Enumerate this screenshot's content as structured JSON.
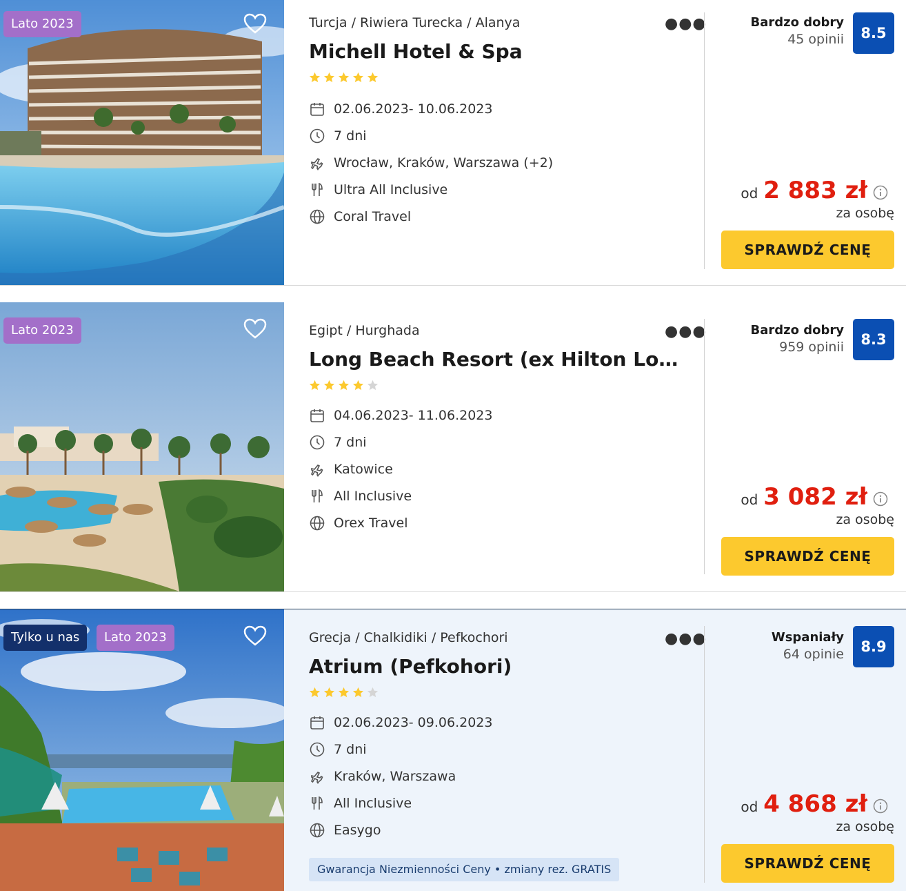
{
  "offers": [
    {
      "badges": [
        "Lato 2023"
      ],
      "location": "Turcja / Riwiera Turecka / Alanya",
      "name": "Michell Hotel & Spa",
      "stars": 5,
      "dates": "02.06.2023- 10.06.2023",
      "duration": "7 dni",
      "departure": "Wrocław, Kraków, Warszawa  (+2)",
      "board": "Ultra All Inclusive",
      "operator": "Coral Travel",
      "rating_label": "Bardzo dobry",
      "rating_count": "45 opinii",
      "score": "8.5",
      "price_prefix": "od",
      "price": "2 883 zł",
      "price_suffix": "za osobę",
      "button": "SPRAWDŹ CENĘ"
    },
    {
      "badges": [
        "Lato 2023"
      ],
      "location": "Egipt / Hurghada",
      "name": "Long Beach Resort (ex Hilton Long Be...",
      "stars": 4,
      "dates": "04.06.2023- 11.06.2023",
      "duration": "7 dni",
      "departure": "Katowice",
      "board": "All Inclusive",
      "operator": "Orex Travel",
      "rating_label": "Bardzo dobry",
      "rating_count": "959 opinii",
      "score": "8.3",
      "price_prefix": "od",
      "price": "3 082 zł",
      "price_suffix": "za osobę",
      "button": "SPRAWDŹ CENĘ"
    },
    {
      "badges": [
        "Tylko u nas",
        "Lato 2023"
      ],
      "location": "Grecja / Chalkidiki / Pefkochori",
      "name": "Atrium (Pefkohori)",
      "stars": 4,
      "dates": "02.06.2023- 09.06.2023",
      "duration": "7 dni",
      "departure": "Kraków, Warszawa",
      "board": "All Inclusive",
      "operator": "Easygo",
      "guarantee": "Gwarancja Niezmienności Ceny • zmiany rez. GRATIS",
      "rating_label": "Wspaniały",
      "rating_count": "64 opinie",
      "score": "8.9",
      "price_prefix": "od",
      "price": "4 868 zł",
      "price_suffix": "za osobę",
      "button": "SPRAWDŹ CENĘ"
    }
  ],
  "colors": {
    "accent_price": "#e01f0f",
    "score_bg": "#0b4fb3",
    "button_bg": "#fcc92e",
    "badge_lato": "#a36fc9",
    "badge_tylko": "#13306b"
  },
  "icons": [
    "heart-icon",
    "more-icon",
    "star-icon",
    "calendar-icon",
    "clock-icon",
    "plane-icon",
    "cutlery-icon",
    "globe-icon",
    "info-icon"
  ]
}
